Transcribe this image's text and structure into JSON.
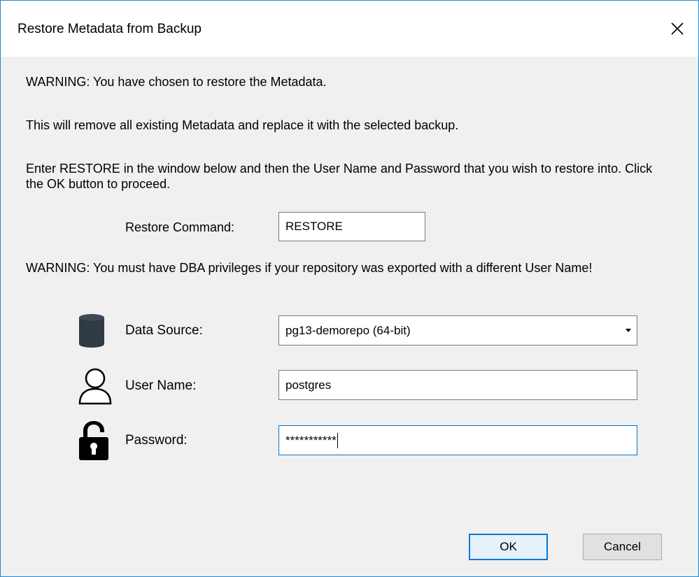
{
  "window": {
    "title": "Restore Metadata from Backup",
    "close_icon": "close-icon"
  },
  "messages": {
    "warning_restore": "WARNING: You have chosen to restore the Metadata.",
    "remove_notice": "This will remove all existing Metadata and replace it with the selected backup.",
    "instructions": "Enter RESTORE in the window below and then the User Name and Password that you wish to restore into. Click the OK button to proceed.",
    "warning_dba": "WARNING: You must have DBA privileges if your repository was exported with a different User Name!"
  },
  "form": {
    "restore_command": {
      "label": "Restore Command:",
      "value": "RESTORE"
    },
    "data_source": {
      "label": "Data Source:",
      "value": "pg13-demorepo (64-bit)",
      "icon": "database-icon"
    },
    "user_name": {
      "label": "User Name:",
      "value": "postgres",
      "icon": "user-icon"
    },
    "password": {
      "label": "Password:",
      "value": "***********",
      "icon": "unlocked-padlock-icon"
    }
  },
  "buttons": {
    "ok": "OK",
    "cancel": "Cancel"
  },
  "colors": {
    "accent": "#0078d7",
    "window_border": "#1e8ad6",
    "background": "#f0f0f0"
  }
}
